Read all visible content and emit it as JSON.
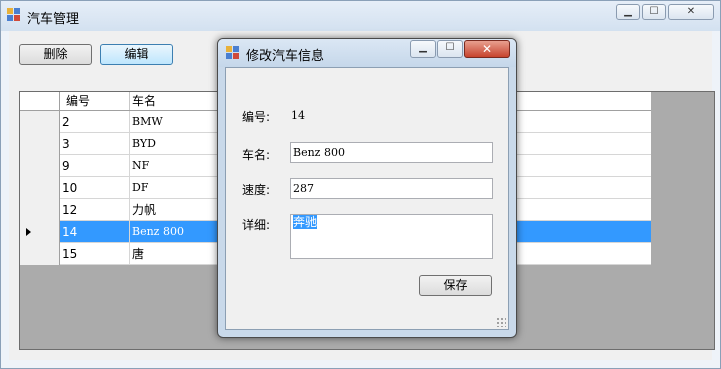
{
  "main_window": {
    "title": "汽车管理",
    "caption": {
      "minimize": "▁",
      "maximize": "☐",
      "close": "✕"
    }
  },
  "toolbar": {
    "delete_label": "删除",
    "edit_label": "编辑"
  },
  "grid": {
    "columns": [
      "编号",
      "车名"
    ],
    "rows": [
      {
        "id": "2",
        "name": "BMW"
      },
      {
        "id": "3",
        "name": "BYD"
      },
      {
        "id": "9",
        "name": "NF"
      },
      {
        "id": "10",
        "name": "DF"
      },
      {
        "id": "12",
        "name": "力帆"
      },
      {
        "id": "14",
        "name": "Benz 800",
        "selected": true
      },
      {
        "id": "15",
        "name": "唐"
      }
    ]
  },
  "dialog": {
    "title": "修改汽车信息",
    "caption": {
      "minimize": "▁",
      "maximize": "☐",
      "close": "✕"
    },
    "id_label": "编号:",
    "id_value": "14",
    "name_label": "车名:",
    "name_value": "Benz 800",
    "speed_label": "速度:",
    "speed_value": "287",
    "detail_label": "详细:",
    "detail_value": "奔驰",
    "save_label": "保存"
  },
  "colors": {
    "selection": "#3399ff",
    "grid_background": "#ababab"
  },
  "icons": [
    "app-icon",
    "minimize-icon",
    "maximize-icon",
    "close-icon",
    "row-selector-arrow-icon",
    "size-grip-icon"
  ]
}
